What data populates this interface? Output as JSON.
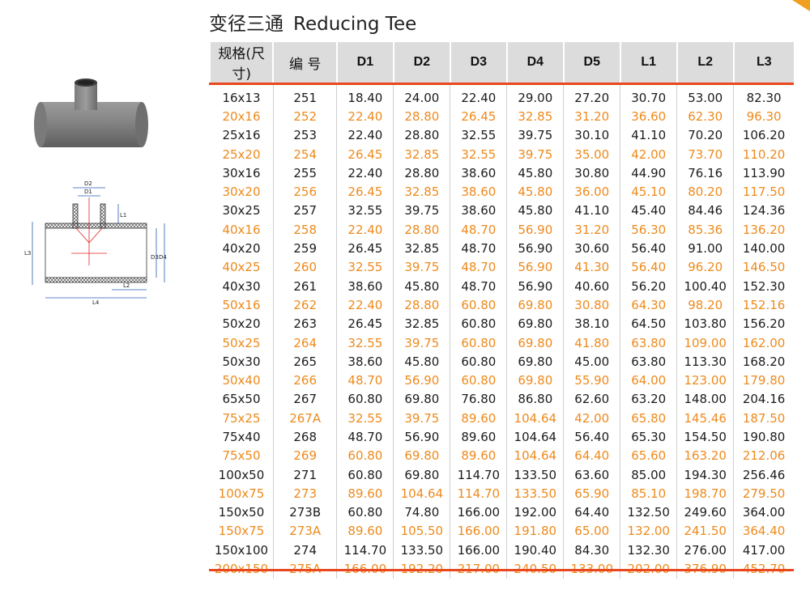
{
  "title": {
    "cn": "变径三通",
    "en": "Reducing Tee"
  },
  "diagram_labels": [
    "D2",
    "D1",
    "L1",
    "L3",
    "D3",
    "D4",
    "L2",
    "L4"
  ],
  "table": {
    "headers": [
      "规格(尺寸)",
      "编 号",
      "D1",
      "D2",
      "D3",
      "D4",
      "D5",
      "L1",
      "L2",
      "L3"
    ],
    "rows": [
      [
        "16x13",
        "251",
        "18.40",
        "24.00",
        "22.40",
        "29.00",
        "27.20",
        "30.70",
        "53.00",
        "82.30"
      ],
      [
        "20x16",
        "252",
        "22.40",
        "28.80",
        "26.45",
        "32.85",
        "31.20",
        "36.60",
        "62.30",
        "96.30"
      ],
      [
        "25x16",
        "253",
        "22.40",
        "28.80",
        "32.55",
        "39.75",
        "30.10",
        "41.10",
        "70.20",
        "106.20"
      ],
      [
        "25x20",
        "254",
        "26.45",
        "32.85",
        "32.55",
        "39.75",
        "35.00",
        "42.00",
        "73.70",
        "110.20"
      ],
      [
        "30x16",
        "255",
        "22.40",
        "28.80",
        "38.60",
        "45.80",
        "30.80",
        "44.90",
        "76.16",
        "113.90"
      ],
      [
        "30x20",
        "256",
        "26.45",
        "32.85",
        "38.60",
        "45.80",
        "36.00",
        "45.10",
        "80.20",
        "117.50"
      ],
      [
        "30x25",
        "257",
        "32.55",
        "39.75",
        "38.60",
        "45.80",
        "41.10",
        "45.40",
        "84.46",
        "124.36"
      ],
      [
        "40x16",
        "258",
        "22.40",
        "28.80",
        "48.70",
        "56.90",
        "31.20",
        "56.30",
        "85.36",
        "136.20"
      ],
      [
        "40x20",
        "259",
        "26.45",
        "32.85",
        "48.70",
        "56.90",
        "30.60",
        "56.40",
        "91.00",
        "140.00"
      ],
      [
        "40x25",
        "260",
        "32.55",
        "39.75",
        "48.70",
        "56.90",
        "41.30",
        "56.40",
        "96.20",
        "146.50"
      ],
      [
        "40x30",
        "261",
        "38.60",
        "45.80",
        "48.70",
        "56.90",
        "40.60",
        "56.20",
        "100.40",
        "152.30"
      ],
      [
        "50x16",
        "262",
        "22.40",
        "28.80",
        "60.80",
        "69.80",
        "30.80",
        "64.30",
        "98.20",
        "152.16"
      ],
      [
        "50x20",
        "263",
        "26.45",
        "32.85",
        "60.80",
        "69.80",
        "38.10",
        "64.50",
        "103.80",
        "156.20"
      ],
      [
        "50x25",
        "264",
        "32.55",
        "39.75",
        "60.80",
        "69.80",
        "41.80",
        "63.80",
        "109.00",
        "162.00"
      ],
      [
        "50x30",
        "265",
        "38.60",
        "45.80",
        "60.80",
        "69.80",
        "45.00",
        "63.80",
        "113.30",
        "168.20"
      ],
      [
        "50x40",
        "266",
        "48.70",
        "56.90",
        "60.80",
        "69.80",
        "55.90",
        "64.00",
        "123.00",
        "179.80"
      ],
      [
        "65x50",
        "267",
        "60.80",
        "69.80",
        "76.80",
        "86.80",
        "62.60",
        "63.20",
        "148.00",
        "204.16"
      ],
      [
        "75x25",
        "267A",
        "32.55",
        "39.75",
        "89.60",
        "104.64",
        "42.00",
        "65.80",
        "145.46",
        "187.50"
      ],
      [
        "75x40",
        "268",
        "48.70",
        "56.90",
        "89.60",
        "104.64",
        "56.40",
        "65.30",
        "154.50",
        "190.80"
      ],
      [
        "75x50",
        "269",
        "60.80",
        "69.80",
        "89.60",
        "104.64",
        "64.40",
        "65.60",
        "163.20",
        "212.06"
      ],
      [
        "100x50",
        "271",
        "60.80",
        "69.80",
        "114.70",
        "133.50",
        "63.60",
        "85.00",
        "194.30",
        "256.46"
      ],
      [
        "100x75",
        "273",
        "89.60",
        "104.64",
        "114.70",
        "133.50",
        "65.90",
        "85.10",
        "198.70",
        "279.50"
      ],
      [
        "150x50",
        "273B",
        "60.80",
        "74.80",
        "166.00",
        "192.00",
        "64.40",
        "132.50",
        "249.60",
        "364.00"
      ],
      [
        "150x75",
        "273A",
        "89.60",
        "105.50",
        "166.00",
        "191.80",
        "65.00",
        "132.00",
        "241.50",
        "364.40"
      ],
      [
        "150x100",
        "274",
        "114.70",
        "133.50",
        "166.00",
        "190.40",
        "84.30",
        "132.30",
        "276.00",
        "417.00"
      ],
      [
        "200x150",
        "275A",
        "166.00",
        "192.20",
        "217.00",
        "240.50",
        "133.00",
        "202.00",
        "376.90",
        "452.70"
      ]
    ]
  },
  "colors": {
    "odd_row_text": "#1c1c1c",
    "even_row_text": "#ee8a1c",
    "header_bg": "#dcdcdc",
    "rule": "#e9481f",
    "corner": "#f0a020"
  }
}
